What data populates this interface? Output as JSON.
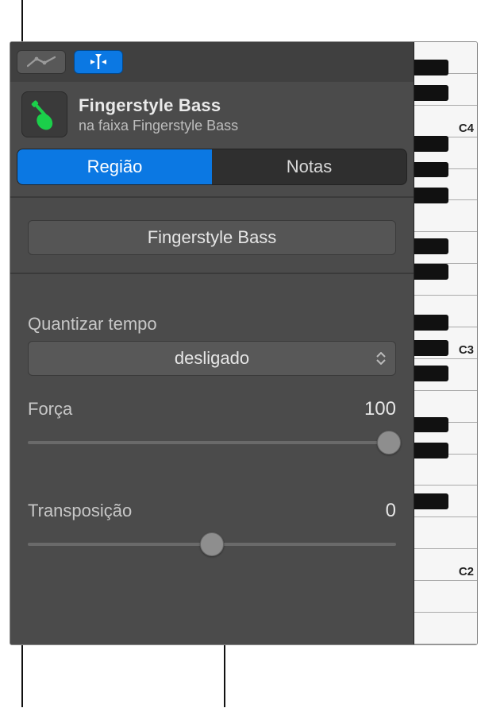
{
  "toolbar": {
    "automation_icon": "automation",
    "catch_icon": "catch-playhead"
  },
  "header": {
    "title": "Fingerstyle Bass",
    "subtitle": "na faixa Fingerstyle Bass"
  },
  "tabs": {
    "region": "Região",
    "notes": "Notas"
  },
  "region_name": "Fingerstyle Bass",
  "quantize": {
    "label": "Quantizar tempo",
    "value": "desligado"
  },
  "strength": {
    "label": "Força",
    "value": "100",
    "percent": 100
  },
  "transpose": {
    "label": "Transposição",
    "value": "0",
    "percent": 50
  },
  "piano_labels": {
    "c4": "C4",
    "c3": "C3",
    "c2": "C2"
  }
}
